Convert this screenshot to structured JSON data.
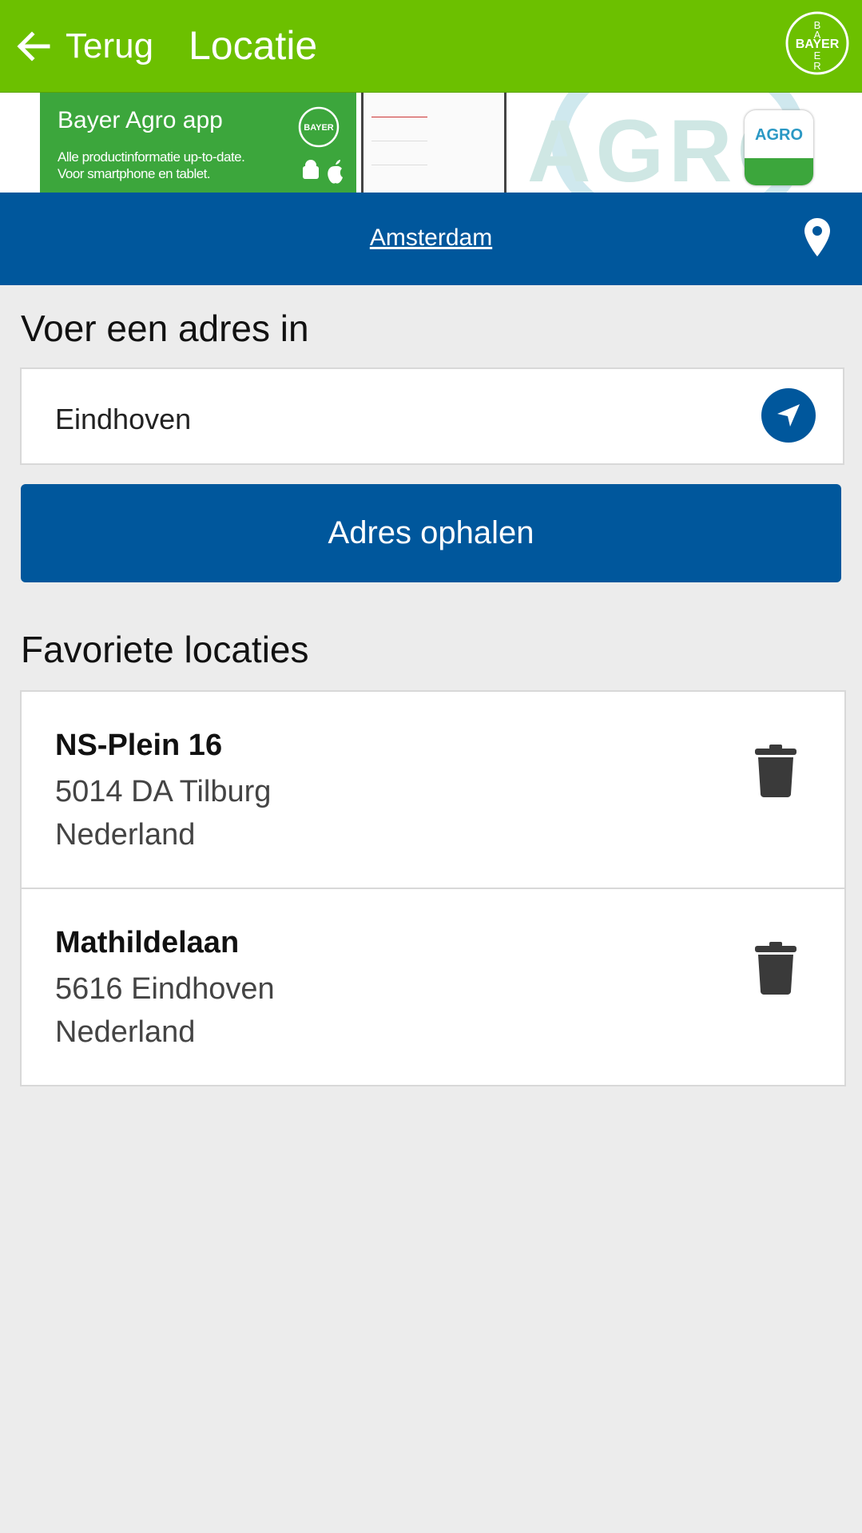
{
  "header": {
    "back_label": "Terug",
    "title": "Locatie",
    "logo_text": "BAYER"
  },
  "banner": {
    "title": "Bayer Agro app",
    "subtitle_line1": "Alle productinformatie up-to-date.",
    "subtitle_line2": "Voor smartphone en tablet.",
    "watermark": "AGRO",
    "badge_text": "AGRO"
  },
  "location_bar": {
    "current_location": "Amsterdam",
    "icon": "map-pin-icon"
  },
  "address_form": {
    "heading": "Voer een adres in",
    "input_value": "Eindhoven",
    "locate_icon": "navigation-arrow-icon",
    "submit_label": "Adres ophalen"
  },
  "favorites": {
    "heading": "Favoriete locaties",
    "items": [
      {
        "street": "NS-Plein 16",
        "city": "5014 DA Tilburg",
        "country": "Nederland"
      },
      {
        "street": "Mathildelaan",
        "city": "5616 Eindhoven",
        "country": "Nederland"
      }
    ],
    "delete_icon": "trash-icon"
  },
  "colors": {
    "appbar": "#6cc000",
    "primary": "#00579c",
    "background": "#ececec"
  }
}
